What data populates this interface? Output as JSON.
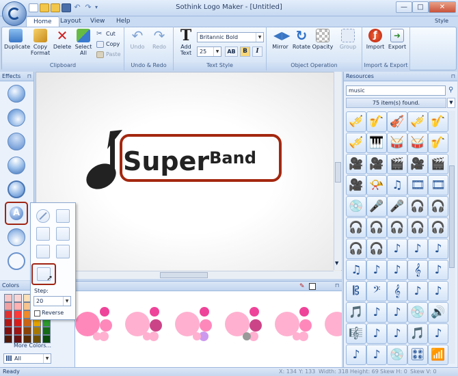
{
  "window": {
    "title": "Sothink Logo Maker - [Untitled]",
    "minimize": "—",
    "maximize": "□",
    "close": "✕"
  },
  "tabs": [
    {
      "label": "Home",
      "active": true
    },
    {
      "label": "Layout",
      "active": false
    },
    {
      "label": "View",
      "active": false
    },
    {
      "label": "Help",
      "active": false
    }
  ],
  "style_menu": "Style",
  "ribbon": {
    "clipboard": {
      "label": "Clipboard",
      "duplicate": "Duplicate",
      "copy_format": "Copy Format",
      "delete": "Delete",
      "select_all": "Select All",
      "cut": "Cut",
      "copy": "Copy",
      "paste": "Paste"
    },
    "undo_redo": {
      "label": "Undo & Redo",
      "undo": "Undo",
      "redo": "Redo"
    },
    "text_style": {
      "label": "Text Style",
      "add_text": "Add Text",
      "font": "Britannic Bold",
      "size": "25",
      "bold": "B",
      "italic": "I",
      "ab": "AB"
    },
    "object_operation": {
      "label": "Object Operation",
      "mirror": "Mirror",
      "rotate": "Rotate",
      "opacity": "Opacity",
      "group": "Group"
    },
    "import_export": {
      "label": "Import & Export",
      "import": "Import",
      "export": "Export"
    }
  },
  "effects_panel": {
    "title": "Effects",
    "pin": "⊓"
  },
  "effect_popup": {
    "step_label": "Step:",
    "step_value": "20",
    "reverse_label": "Reverse",
    "reverse_checked": false
  },
  "logo": {
    "text_main": "Super",
    "text_band": "Band",
    "colors": {
      "frame": "#a3270f",
      "text": "#222222"
    }
  },
  "colors_panel": {
    "title": "Colors",
    "more_colors": "More Colors...",
    "filter": "All",
    "swatches": [
      "#f6c8c8",
      "#f8d5d5",
      "#fbe0b8",
      "#fff2b0",
      "#e3f3b0",
      "#f0a0a0",
      "#ffb0b0",
      "#f7c48e",
      "#ffe680",
      "#c9e58a",
      "#e03030",
      "#ff3838",
      "#ee8a2a",
      "#ffd21e",
      "#7cc132",
      "#b01818",
      "#d81c1c",
      "#c86414",
      "#e2a200",
      "#2c9a2c",
      "#801010",
      "#a01414",
      "#8a4206",
      "#a67800",
      "#166c16",
      "#501808",
      "#6a1010",
      "#5a2c04",
      "#705000",
      "#0a4a0a"
    ]
  },
  "palette": {
    "colors": [
      "#ff88bb",
      "#ee4499",
      "#ffb0d0",
      "#cc4488",
      "#999999",
      "#cc99ee"
    ]
  },
  "resources": {
    "title": "Resources",
    "search_value": "music",
    "result_text": "75 item(s) found.",
    "icons": [
      "🎺",
      "🎷",
      "🎻",
      "🎺",
      "🎷",
      "🎺",
      "🎹",
      "🥁",
      "🥁",
      "🎷",
      "🎥",
      "🎥",
      "🎬",
      "🎥",
      "🎬",
      "🎥",
      "📯",
      "♫",
      "🎞",
      "🎞",
      "💿",
      "🎤",
      "🎤",
      "🎧",
      "🎧",
      "🎧",
      "🎧",
      "🎧",
      "🎧",
      "🎧",
      "🎧",
      "🎧",
      "♪",
      "♪",
      "♪",
      "♫",
      "♪",
      "♪",
      "𝄞",
      "♪",
      "𝄡",
      "𝄢",
      "𝄞",
      "♪",
      "♪",
      "🎵",
      "♪",
      "♪",
      "💿",
      "🔊",
      "🎼",
      "♪",
      "♪",
      "🎵",
      "♪",
      "♪",
      "♪",
      "💿",
      "🎛",
      "📶"
    ]
  },
  "status": {
    "ready": "Ready",
    "x": "X: 134",
    "y": "Y: 133",
    "width": "Width: 318",
    "height": "Height: 69",
    "skewh": "Skew H: 0",
    "skewv": "Skew V: 0"
  }
}
